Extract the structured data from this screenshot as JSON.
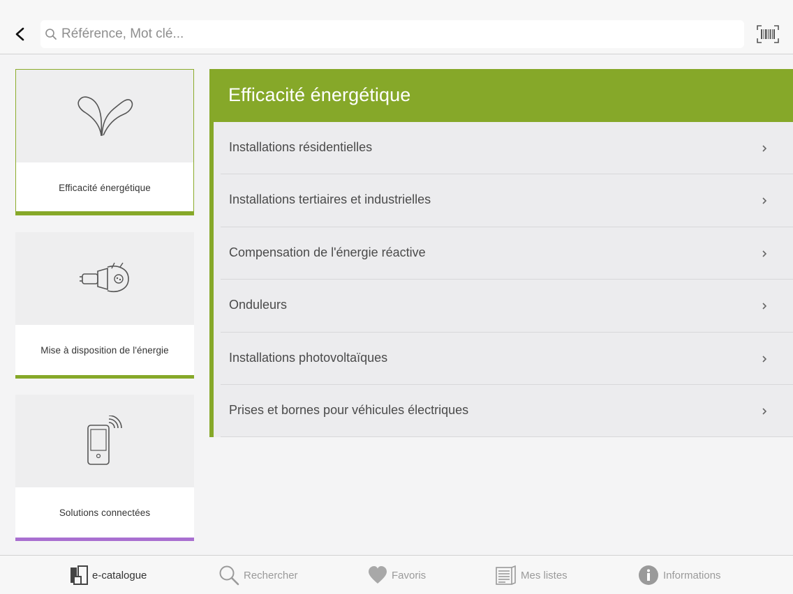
{
  "search": {
    "placeholder": "Référence, Mot clé..."
  },
  "icons": {
    "back": "chevron-left-icon",
    "search": "magnifier-icon",
    "barcode": "barcode-scanner-icon"
  },
  "categories": [
    {
      "label": "Efficacité énergétique",
      "icon": "sprout-icon",
      "accent": "#86a829",
      "selected": true
    },
    {
      "label": "Mise à disposition de l'énergie",
      "icon": "plug-icon",
      "accent": "#86a829",
      "selected": false
    },
    {
      "label": "Solutions connectées",
      "icon": "connected-phone-icon",
      "accent": "#a86fd0",
      "selected": false
    }
  ],
  "panel": {
    "title": "Efficacité énergétique",
    "accent": "#86a829",
    "items": [
      {
        "label": "Installations résidentielles"
      },
      {
        "label": "Installations tertiaires et industrielles"
      },
      {
        "label": "Compensation de l'énergie réactive"
      },
      {
        "label": "Onduleurs"
      },
      {
        "label": "Installations photovoltaïques"
      },
      {
        "label": "Prises et bornes pour véhicules électriques"
      }
    ]
  },
  "tabbar": {
    "tabs": [
      {
        "label": "e-catalogue",
        "icon": "catalogue-icon",
        "active": true
      },
      {
        "label": "Rechercher",
        "icon": "search-icon",
        "active": false
      },
      {
        "label": "Favoris",
        "icon": "heart-icon",
        "active": false
      },
      {
        "label": "Mes listes",
        "icon": "list-icon",
        "active": false
      },
      {
        "label": "Informations",
        "icon": "info-icon",
        "active": false
      }
    ]
  }
}
